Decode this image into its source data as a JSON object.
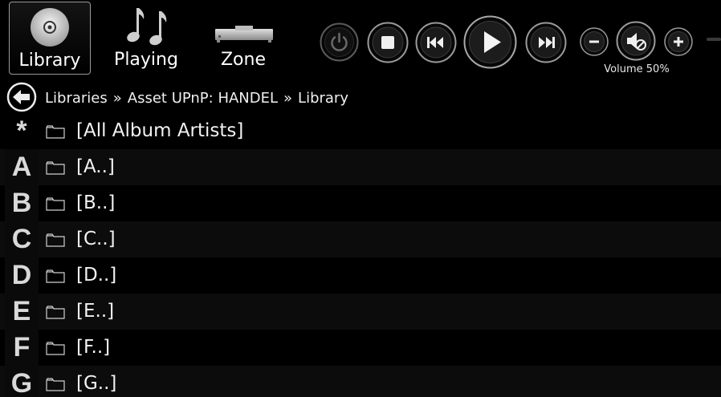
{
  "nav": {
    "tabs": [
      {
        "label": "Library",
        "icon": "disc-icon",
        "active": true
      },
      {
        "label": "Playing",
        "icon": "music-notes-icon",
        "active": false
      },
      {
        "label": "Zone",
        "icon": "player-device-icon",
        "active": false
      }
    ]
  },
  "transport": {
    "buttons": [
      "power-icon",
      "stop-icon",
      "previous-icon",
      "play-icon",
      "next-icon"
    ],
    "volume": {
      "label": "Volume 50%",
      "level_percent": 50,
      "buttons": [
        "volume-down-icon",
        "mute-icon",
        "volume-up-icon"
      ]
    }
  },
  "breadcrumb": {
    "items": [
      "Libraries",
      "Asset UPnP: HANDEL",
      "Library"
    ],
    "separator": "»"
  },
  "list": {
    "rows": [
      {
        "index": "*",
        "label": "[All Album Artists]"
      },
      {
        "index": "A",
        "label": "[A..]"
      },
      {
        "index": "B",
        "label": "[B..]"
      },
      {
        "index": "C",
        "label": "[C..]"
      },
      {
        "index": "D",
        "label": "[D..]"
      },
      {
        "index": "E",
        "label": "[E..]"
      },
      {
        "index": "F",
        "label": "[F..]"
      },
      {
        "index": "G",
        "label": "[G..]"
      }
    ]
  },
  "colors": {
    "background": "#000000",
    "text": "#f2f2f2",
    "row_alt": "#0c0c0c",
    "button_ring": "#8a8a8a"
  }
}
